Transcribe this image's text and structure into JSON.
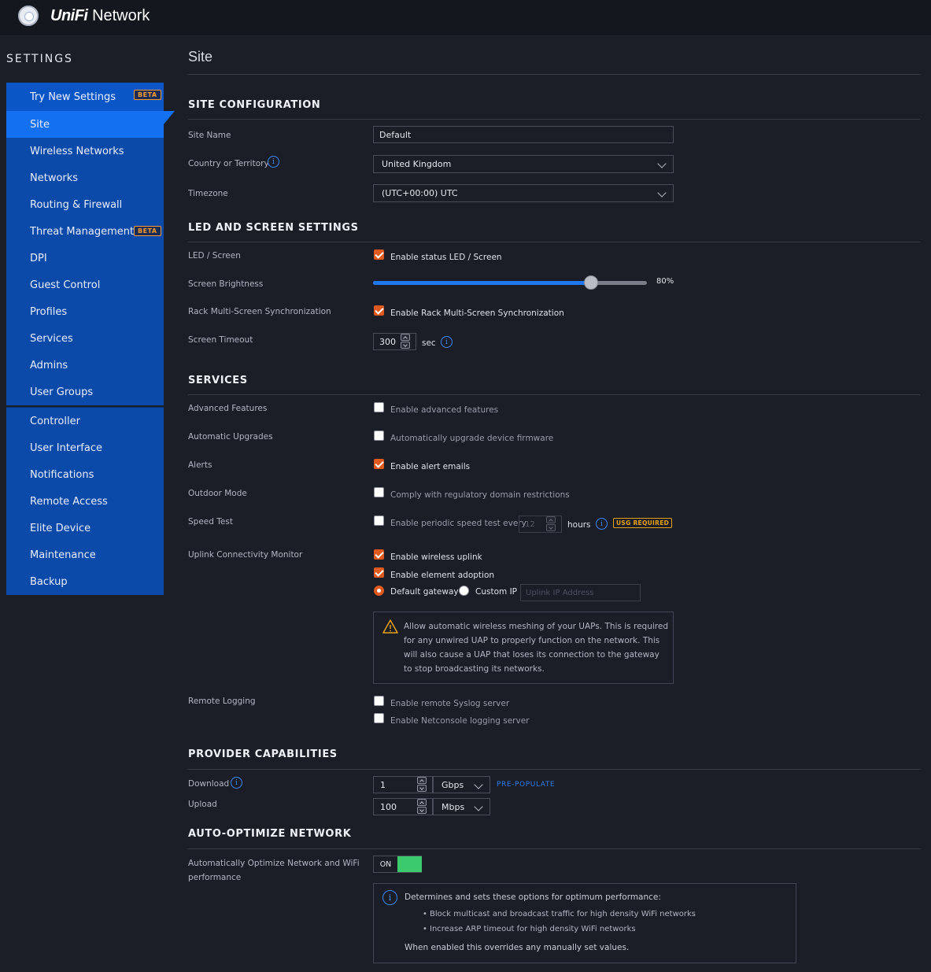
{
  "app": {
    "brand_unifi": "UniFi",
    "brand_network": "Network"
  },
  "sidebar": {
    "heading": "SETTINGS",
    "items": [
      {
        "label": "Try New Settings",
        "badge": "BETA"
      },
      {
        "label": "Site"
      },
      {
        "label": "Wireless Networks"
      },
      {
        "label": "Networks"
      },
      {
        "label": "Routing & Firewall"
      },
      {
        "label": "Threat Management",
        "badge": "BETA"
      },
      {
        "label": "DPI"
      },
      {
        "label": "Guest Control"
      },
      {
        "label": "Profiles"
      },
      {
        "label": "Services"
      },
      {
        "label": "Admins"
      },
      {
        "label": "User Groups"
      }
    ],
    "items2": [
      {
        "label": "Controller"
      },
      {
        "label": "User Interface"
      },
      {
        "label": "Notifications"
      },
      {
        "label": "Remote Access"
      },
      {
        "label": "Elite Device"
      },
      {
        "label": "Maintenance"
      },
      {
        "label": "Backup"
      }
    ],
    "active": "Site"
  },
  "page": {
    "title": "Site"
  },
  "site_config": {
    "title": "SITE CONFIGURATION",
    "site_name_label": "Site Name",
    "site_name_value": "Default",
    "country_label": "Country or Territory",
    "country_value": "United Kingdom",
    "timezone_label": "Timezone",
    "timezone_value": "(UTC+00:00) UTC"
  },
  "led": {
    "title": "LED AND SCREEN SETTINGS",
    "led_label": "LED / Screen",
    "led_cb": "Enable status LED / Screen",
    "brightness_label": "Screen Brightness",
    "brightness_value": "80%",
    "brightness_fraction": 0.8,
    "rack_label": "Rack Multi-Screen Synchronization",
    "rack_cb": "Enable Rack Multi-Screen Synchronization",
    "timeout_label": "Screen Timeout",
    "timeout_value": "300",
    "timeout_unit": "sec"
  },
  "services": {
    "title": "SERVICES",
    "advanced_label": "Advanced Features",
    "advanced_cb": "Enable advanced features",
    "upgrades_label": "Automatic Upgrades",
    "upgrades_cb": "Automatically upgrade device firmware",
    "alerts_label": "Alerts",
    "alerts_cb": "Enable alert emails",
    "outdoor_label": "Outdoor Mode",
    "outdoor_cb": "Comply with regulatory domain restrictions",
    "speed_label": "Speed Test",
    "speed_cb": "Enable periodic speed test every",
    "speed_value": "12",
    "speed_unit": "hours",
    "speed_badge": "USG REQUIRED",
    "uplink_label": "Uplink Connectivity Monitor",
    "uplink_cb1": "Enable wireless uplink",
    "uplink_cb2": "Enable element adoption",
    "radio_default": "Default gateway",
    "radio_custom": "Custom IP",
    "uplink_placeholder": "Uplink IP Address",
    "warning_text": "Allow automatic wireless meshing of your UAPs. This is required for any unwired UAP to properly function on the network. This will also cause a UAP that loses its connection to the gateway to stop broadcasting its networks.",
    "logging_label": "Remote Logging",
    "logging_cb1": "Enable remote Syslog server",
    "logging_cb2": "Enable Netconsole logging server"
  },
  "provider": {
    "title": "PROVIDER CAPABILITIES",
    "download_label": "Download",
    "download_value": "1",
    "download_unit": "Gbps",
    "prepopulate": "PRE-POPULATE",
    "upload_label": "Upload",
    "upload_value": "100",
    "upload_unit": "Mbps"
  },
  "auto_optimize": {
    "title": "AUTO-OPTIMIZE NETWORK",
    "label_line1": "Automatically Optimize Network and WiFi",
    "label_line2": "performance",
    "toggle": "ON",
    "info_heading": "Determines and sets these options for optimum performance:",
    "bullet1": "Block multicast and broadcast traffic for high density WiFi networks",
    "bullet2": "Increase ARP timeout for high density WiFi networks",
    "info_footer": "When enabled this overrides any manually set values."
  }
}
